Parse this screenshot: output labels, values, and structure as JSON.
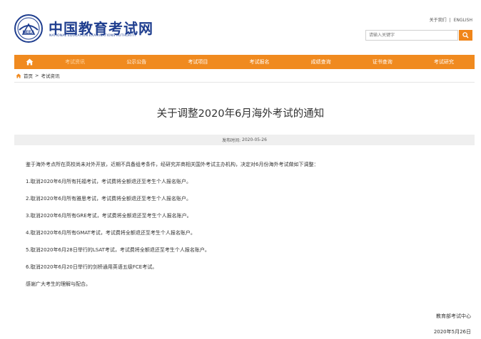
{
  "header": {
    "site_title": "中国教育考试网",
    "site_subtitle": "NATIONAL EDUCATION EXAMINATIONS AUTHORITY",
    "logo_text": "NEEA",
    "top_links": {
      "about": "关于我们",
      "separator": "|",
      "english": "ENGLISH"
    },
    "search": {
      "placeholder": "请输入关键字"
    }
  },
  "nav": {
    "home_icon": "home-icon",
    "items": [
      {
        "label": "考试资讯",
        "active": true
      },
      {
        "label": "公示公告",
        "active": false
      },
      {
        "label": "考试项目",
        "active": false
      },
      {
        "label": "考试报名",
        "active": false
      },
      {
        "label": "成绩查询",
        "active": false
      },
      {
        "label": "证书查询",
        "active": false
      },
      {
        "label": "考试研究",
        "active": false
      }
    ]
  },
  "breadcrumb": {
    "home": "首页",
    "separator": ">",
    "current": "考试资讯"
  },
  "article": {
    "title": "关于调整2020年6月海外考试的通知",
    "publish_label": "发布时间:",
    "publish_date": "2020-05-26",
    "paragraphs": [
      "鉴于海外考点所在高校尚未对外开放，近期不具备组考条件，经研究并商相关国外考试主办机构，决定对6月份海外考试做如下调整：",
      "1.取消2020年6月所有托福考试，考试费将全额退还至考生个人报名账户。",
      "2.取消2020年6月所有雅思考试，考试费将全额退还至考生个人报名账户。",
      "3.取消2020年6月所有GRE考试，考试费将全额退还至考生个人报名账户。",
      "4.取消2020年6月所有GMAT考试，考试费将全额退还至考生个人报名账户。",
      "5.取消2020年6月28日举行的LSAT考试，考试费将全额退还至考生个人报名账户。",
      "6.取消2020年6月20日举行的剑桥通用英语五级FCE考试。",
      "感谢广大考生的理解与配合。"
    ],
    "signature_org": "教育部考试中心",
    "signature_date": "2020年5月26日"
  },
  "colors": {
    "accent": "#f08a1f",
    "brand": "#1f3e8f",
    "meta_bg": "#efefef"
  }
}
